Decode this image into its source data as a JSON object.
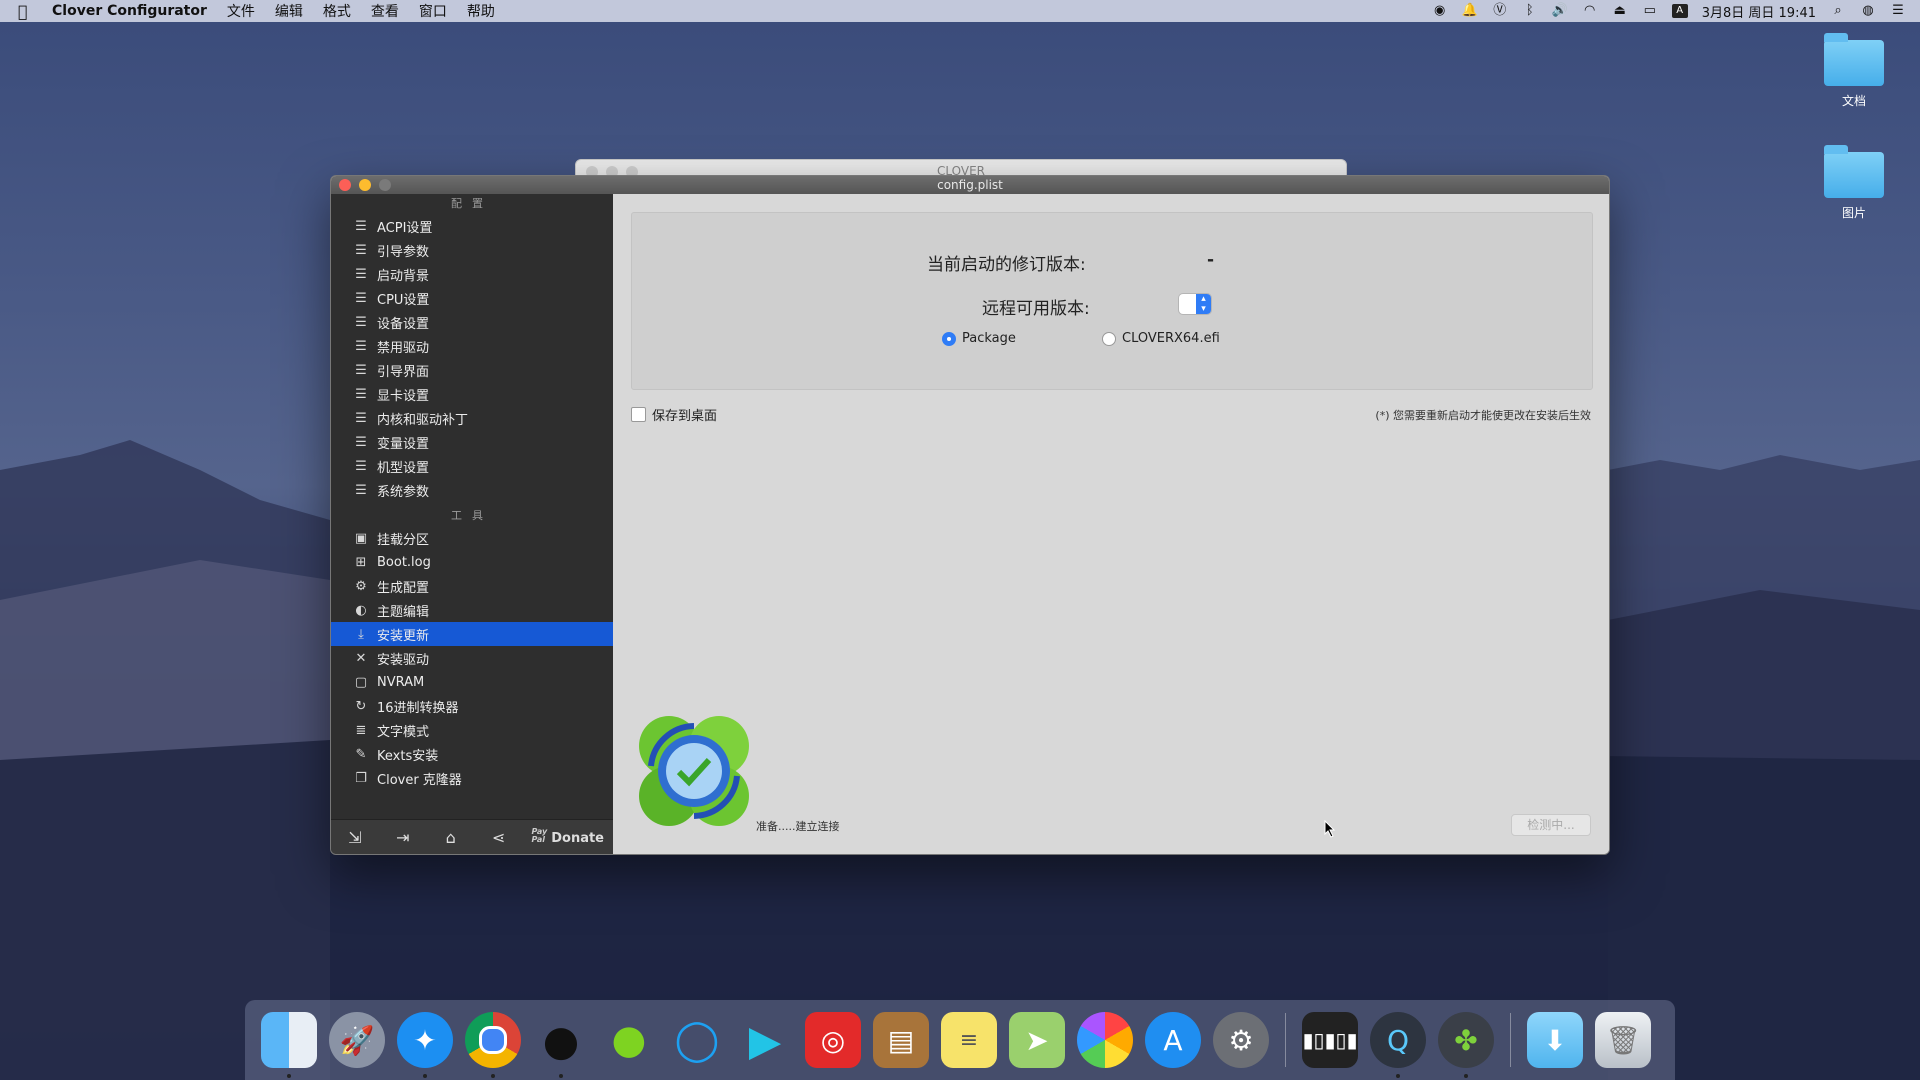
{
  "menubar": {
    "app_name": "Clover Configurator",
    "items": [
      "文件",
      "编辑",
      "格式",
      "查看",
      "窗口",
      "帮助"
    ],
    "datetime": "3月8日 周日 19:41",
    "input_method": "A"
  },
  "desktop": {
    "icons": [
      {
        "label": "文档"
      },
      {
        "label": "图片"
      }
    ]
  },
  "bg_window": {
    "title": "CLOVER"
  },
  "window": {
    "title": "config.plist",
    "sidebar": {
      "section_config": "配置",
      "config_items": [
        {
          "label": "ACPI设置",
          "icon": "list-icon"
        },
        {
          "label": "引导参数",
          "icon": "list-icon"
        },
        {
          "label": "启动背景",
          "icon": "list-icon"
        },
        {
          "label": "CPU设置",
          "icon": "list-icon"
        },
        {
          "label": "设备设置",
          "icon": "list-icon"
        },
        {
          "label": "禁用驱动",
          "icon": "list-icon"
        },
        {
          "label": "引导界面",
          "icon": "list-icon"
        },
        {
          "label": "显卡设置",
          "icon": "list-icon"
        },
        {
          "label": "内核和驱动补丁",
          "icon": "list-icon"
        },
        {
          "label": "变量设置",
          "icon": "list-icon"
        },
        {
          "label": "机型设置",
          "icon": "list-icon"
        },
        {
          "label": "系统参数",
          "icon": "list-icon"
        }
      ],
      "section_tools": "工具",
      "tool_items": [
        {
          "label": "挂载分区",
          "icon": "disk-icon"
        },
        {
          "label": "Boot.log",
          "icon": "log-icon"
        },
        {
          "label": "生成配置",
          "icon": "gears-icon"
        },
        {
          "label": "主题编辑",
          "icon": "palette-icon"
        },
        {
          "label": "安装更新",
          "icon": "download-icon",
          "selected": true
        },
        {
          "label": "安装驱动",
          "icon": "tools-icon"
        },
        {
          "label": "NVRAM",
          "icon": "chip-icon"
        },
        {
          "label": "16进制转换器",
          "icon": "refresh-icon"
        },
        {
          "label": "文字模式",
          "icon": "text-icon"
        },
        {
          "label": "Kexts安装",
          "icon": "wrench-icon"
        },
        {
          "label": "Clover 克隆器",
          "icon": "copy-icon"
        }
      ],
      "bottom": {
        "paypal_top": "Pay",
        "paypal_bottom": "Pal",
        "donate_label": "Donate"
      }
    },
    "content": {
      "current_version_label": "当前启动的修订版本:",
      "current_version_value": "-",
      "remote_version_label": "远程可用版本:",
      "radio_package": "Package",
      "radio_efi": "CLOVERX64.efi",
      "selected_radio": "Package",
      "save_to_desktop": "保存到桌面",
      "note": "(*) 您需要重新启动才能使更改在安装后生效",
      "status": "准备.....建立连接",
      "check_button": "检测中..."
    }
  },
  "dock": {
    "apps": [
      "finder",
      "launchpad",
      "safari",
      "chrome",
      "qq",
      "wechat",
      "messages",
      "infuse",
      "netease-music",
      "contacts",
      "notes",
      "maps",
      "photos",
      "app-store",
      "system-preferences",
      "piano",
      "quicktime",
      "clover-configurator",
      "downloads",
      "trash"
    ]
  },
  "colors": {
    "accent": "#1659d5",
    "sidebar_bg": "#2e2e2e",
    "content_bg": "#d8d8d8"
  }
}
